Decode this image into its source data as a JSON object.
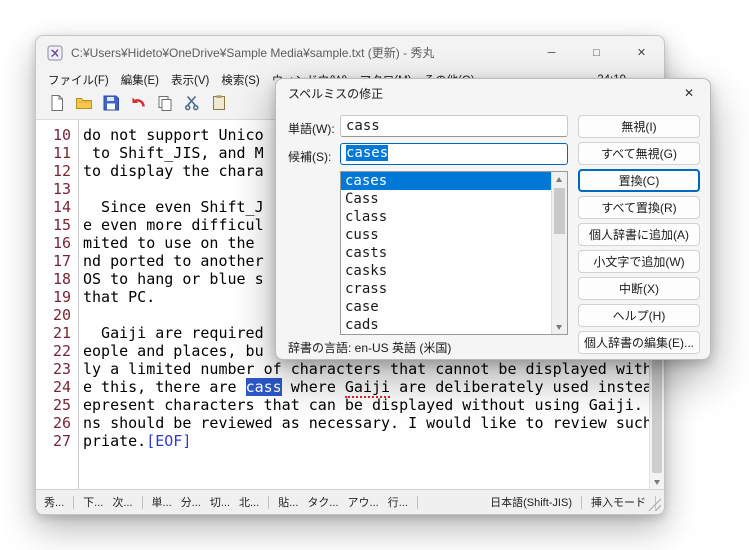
{
  "window": {
    "title": "C:¥Users¥Hideto¥OneDrive¥Sample Media¥sample.txt (更新) - 秀丸",
    "minimize_glyph": "─",
    "maximize_glyph": "□",
    "close_glyph": "✕"
  },
  "menubar": {
    "items": [
      "ファイル(F)",
      "編集(E)",
      "表示(V)",
      "検索(S)",
      "ウィンドウ(W)",
      "マクロ(M)",
      "その他(O)"
    ],
    "cursor_position": "24:19"
  },
  "toolbar": {
    "icons": [
      "new-file",
      "open-folder",
      "save",
      "undo",
      "copy",
      "cut",
      "paste"
    ]
  },
  "editor": {
    "lines": [
      {
        "num": "10",
        "text": "do not support Unico"
      },
      {
        "num": "11",
        "text": " to Shift_JIS, and M"
      },
      {
        "num": "12",
        "text": "to display the chara"
      },
      {
        "num": "13",
        "text": ""
      },
      {
        "num": "14",
        "text": "  Since even Shift_J"
      },
      {
        "num": "15",
        "text": "e even more difficul"
      },
      {
        "num": "16",
        "text": "mited to use on the"
      },
      {
        "num": "17",
        "text": "nd ported to another"
      },
      {
        "num": "18",
        "text": "OS to hang or blue s"
      },
      {
        "num": "19",
        "text": "that PC."
      },
      {
        "num": "20",
        "text": ""
      },
      {
        "num": "21",
        "text": "  Gaiji are required"
      },
      {
        "num": "22",
        "text": "eople and places, bu"
      },
      {
        "num": "23",
        "text": "ly a limited number of characters that cannot be displayed with"
      },
      {
        "num": "24",
        "before": "e this, there are ",
        "selected": "cass",
        "mid": " where ",
        "misspelled": "Gaiji",
        "after": " are deliberately used instea"
      },
      {
        "num": "25",
        "text": "epresent characters that can be displayed without using Gaiji."
      },
      {
        "num": "26",
        "text": "ns should be reviewed as necessary. I would like to review such"
      },
      {
        "num": "27",
        "text": "priate.",
        "eof": "[EOF]"
      }
    ]
  },
  "statusbar": {
    "segments": [
      "秀...",
      "下...",
      "次...",
      "単...",
      "分...",
      "切...",
      "北...",
      "貼...",
      "タク...",
      "アウ...",
      "行...",
      "日本語(Shift-JIS)",
      "挿入モード"
    ]
  },
  "dialog": {
    "title": "スペルミスの修正",
    "close_glyph": "✕",
    "word_label": "単語(W):",
    "word_value": "cass",
    "suggestion_label": "候補(S):",
    "suggestion_value": "cases",
    "candidates": [
      "cases",
      "Cass",
      "class",
      "cuss",
      "casts",
      "casks",
      "crass",
      "case",
      "cads"
    ],
    "dictionary_language": "辞書の言語: en-US 英語 (米国)",
    "buttons": [
      {
        "label": "無視(I)"
      },
      {
        "label": "すべて無視(G)"
      },
      {
        "label": "置換(C)",
        "focused": true
      },
      {
        "label": "すべて置換(R)"
      },
      {
        "label": "個人辞書に追加(A)"
      },
      {
        "label": "小文字で追加(W)"
      },
      {
        "label": "中断(X)"
      },
      {
        "label": "ヘルプ(H)"
      },
      {
        "label": "個人辞書の編集(E)..."
      }
    ]
  },
  "colors": {
    "accent": "#0078d7",
    "editor_selection": "#2b59c8",
    "line_number": "#7a2433",
    "misspell_underline": "#e02525",
    "eof_marker": "#2a3bd0",
    "focused_button_border": "#0067c0"
  }
}
